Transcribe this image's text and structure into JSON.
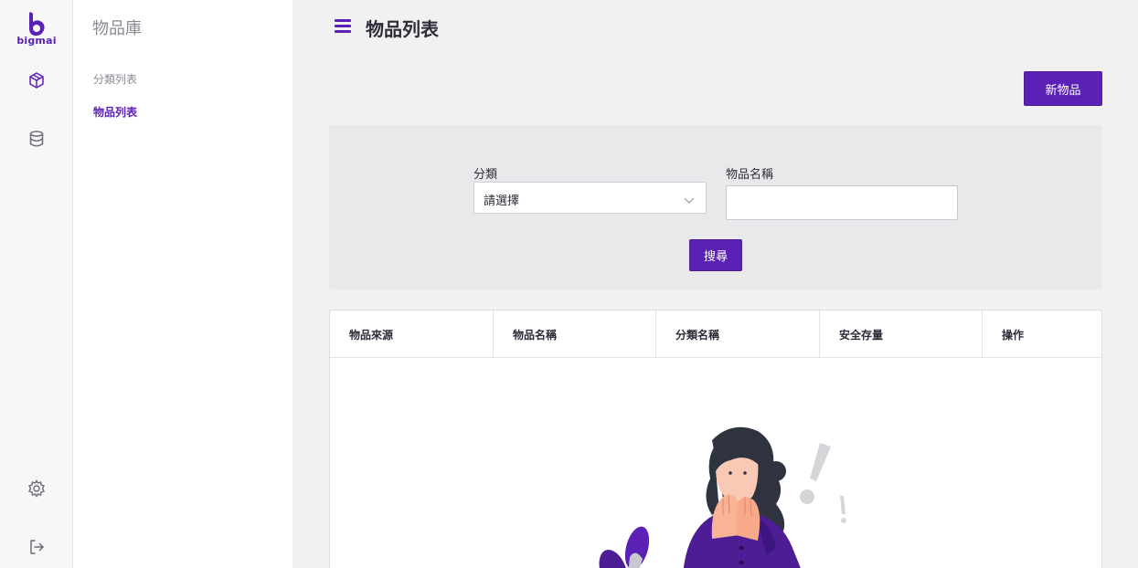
{
  "brand": {
    "name": "bigmai",
    "color": "#5b21b6"
  },
  "rail": {
    "items": [
      {
        "icon": "cube-icon"
      },
      {
        "icon": "database-icon"
      },
      {
        "icon": "gear-icon"
      },
      {
        "icon": "logout-icon"
      }
    ]
  },
  "sidebar": {
    "title": "物品庫",
    "items": [
      {
        "label": "分類列表",
        "active": false
      },
      {
        "label": "物品列表",
        "active": true
      }
    ]
  },
  "header": {
    "title": "物品列表",
    "menu_icon": "hamburger-icon"
  },
  "toolbar": {
    "new_item_label": "新物品"
  },
  "filter": {
    "category_label": "分類",
    "category_value": "請選擇",
    "name_label": "物品名稱",
    "name_value": "",
    "search_label": "搜尋"
  },
  "table": {
    "columns": [
      "物品來源",
      "物品名稱",
      "分類名稱",
      "安全存量",
      "操作"
    ],
    "rows": []
  },
  "empty_state": {
    "illustration": "surprised-woman-illustration"
  }
}
